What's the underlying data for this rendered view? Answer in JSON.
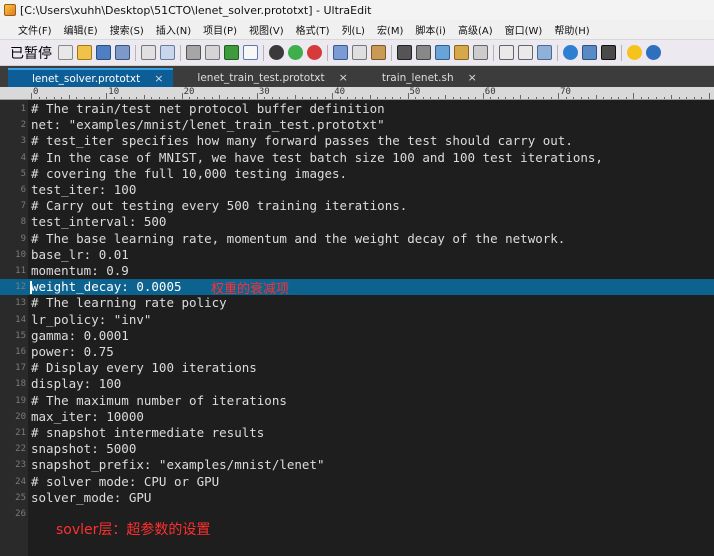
{
  "window": {
    "title": "[C:\\Users\\xuhh\\Desktop\\51CTO\\lenet_solver.prototxt] - UltraEdit"
  },
  "menu": [
    "文件(F)",
    "编辑(E)",
    "搜索(S)",
    "插入(N)",
    "项目(P)",
    "视图(V)",
    "格式(T)",
    "列(L)",
    "宏(M)",
    "脚本(i)",
    "高级(A)",
    "窗口(W)",
    "帮助(H)"
  ],
  "toolbar": {
    "status_overlay": "已暂停"
  },
  "tabs": [
    {
      "label": "lenet_solver.prototxt",
      "active": true
    },
    {
      "label": "lenet_train_test.prototxt",
      "active": false
    },
    {
      "label": "train_lenet.sh",
      "active": false
    }
  ],
  "ruler": {
    "labels": [
      "0",
      "10",
      "20",
      "30",
      "40",
      "50",
      "60",
      "70"
    ]
  },
  "lines": [
    {
      "n": "1",
      "text": "# The train/test net protocol buffer definition"
    },
    {
      "n": "2",
      "text": "net: \"examples/mnist/lenet_train_test.prototxt\""
    },
    {
      "n": "3",
      "text": "# test_iter specifies how many forward passes the test should carry out."
    },
    {
      "n": "4",
      "text": "# In the case of MNIST, we have test batch size 100 and 100 test iterations,"
    },
    {
      "n": "5",
      "text": "# covering the full 10,000 testing images."
    },
    {
      "n": "6",
      "text": "test_iter: 100"
    },
    {
      "n": "7",
      "text": "# Carry out testing every 500 training iterations."
    },
    {
      "n": "8",
      "text": "test_interval: 500"
    },
    {
      "n": "9",
      "text": "# The base learning rate, momentum and the weight decay of the network."
    },
    {
      "n": "10",
      "text": "base_lr: 0.01"
    },
    {
      "n": "11",
      "text": "momentum: 0.9"
    },
    {
      "n": "12",
      "text": "weight_decay: 0.0005",
      "highlighted": true
    },
    {
      "n": "13",
      "text": "# The learning rate policy"
    },
    {
      "n": "14",
      "text": "lr_policy: \"inv\""
    },
    {
      "n": "15",
      "text": "gamma: 0.0001"
    },
    {
      "n": "16",
      "text": "power: 0.75"
    },
    {
      "n": "17",
      "text": "# Display every 100 iterations"
    },
    {
      "n": "18",
      "text": "display: 100"
    },
    {
      "n": "19",
      "text": "# The maximum number of iterations"
    },
    {
      "n": "20",
      "text": "max_iter: 10000"
    },
    {
      "n": "21",
      "text": "# snapshot intermediate results"
    },
    {
      "n": "22",
      "text": "snapshot: 5000"
    },
    {
      "n": "23",
      "text": "snapshot_prefix: \"examples/mnist/lenet\""
    },
    {
      "n": "24",
      "text": "# solver mode: CPU or GPU"
    },
    {
      "n": "25",
      "text": "solver_mode: GPU"
    },
    {
      "n": "26",
      "text": ""
    }
  ],
  "annotations": {
    "weight_decay_note": "权重的衰减项",
    "footer_note": "sovler层：超参数的设置"
  },
  "colors": {
    "editor_bg": "#1e1e1e",
    "highlight_line": "#0d6390",
    "annotation": "#ff2f2f",
    "active_tab": "#0d5d97"
  }
}
